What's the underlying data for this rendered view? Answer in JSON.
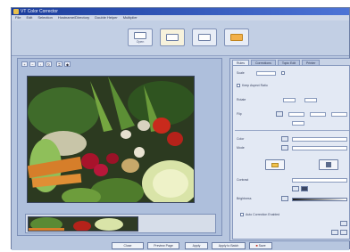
{
  "window": {
    "title": "VT Color Corrector"
  },
  "menu": [
    "File",
    "Edit",
    "Selection",
    "Hostname/Directory",
    "Double Helper",
    "Multiplier"
  ],
  "toolbar": {
    "buttons": [
      {
        "label": "Open",
        "icon": "document-icon"
      },
      {
        "label": "",
        "icon": "camera-icon"
      },
      {
        "label": "",
        "icon": "tray-icon"
      },
      {
        "label": "",
        "icon": "hand-icon"
      }
    ]
  },
  "left": {
    "mini_tools": [
      "",
      "",
      "",
      "",
      "",
      ""
    ]
  },
  "right": {
    "tabs": [
      "Rules",
      "Corrections",
      "Topic Edit",
      "Printer"
    ],
    "labels": {
      "scale": "Scale",
      "keep_aspect": "Keep Aspect Ratio",
      "rotate": "Rotate",
      "flip": "Flip",
      "color": "Color",
      "mode": "Mode",
      "contrast": "Contrast",
      "brightness": "Brightness",
      "auto_correction": "Auto Correction Enabled"
    }
  },
  "footer": {
    "buttons": [
      "Close",
      "Preview Page",
      "Apply",
      "Apply to Batch",
      "Save"
    ]
  },
  "colors": {
    "title_bar": "#1b3d9c",
    "panel_bg": "#b7c6df",
    "accent": "#f2b04a"
  }
}
